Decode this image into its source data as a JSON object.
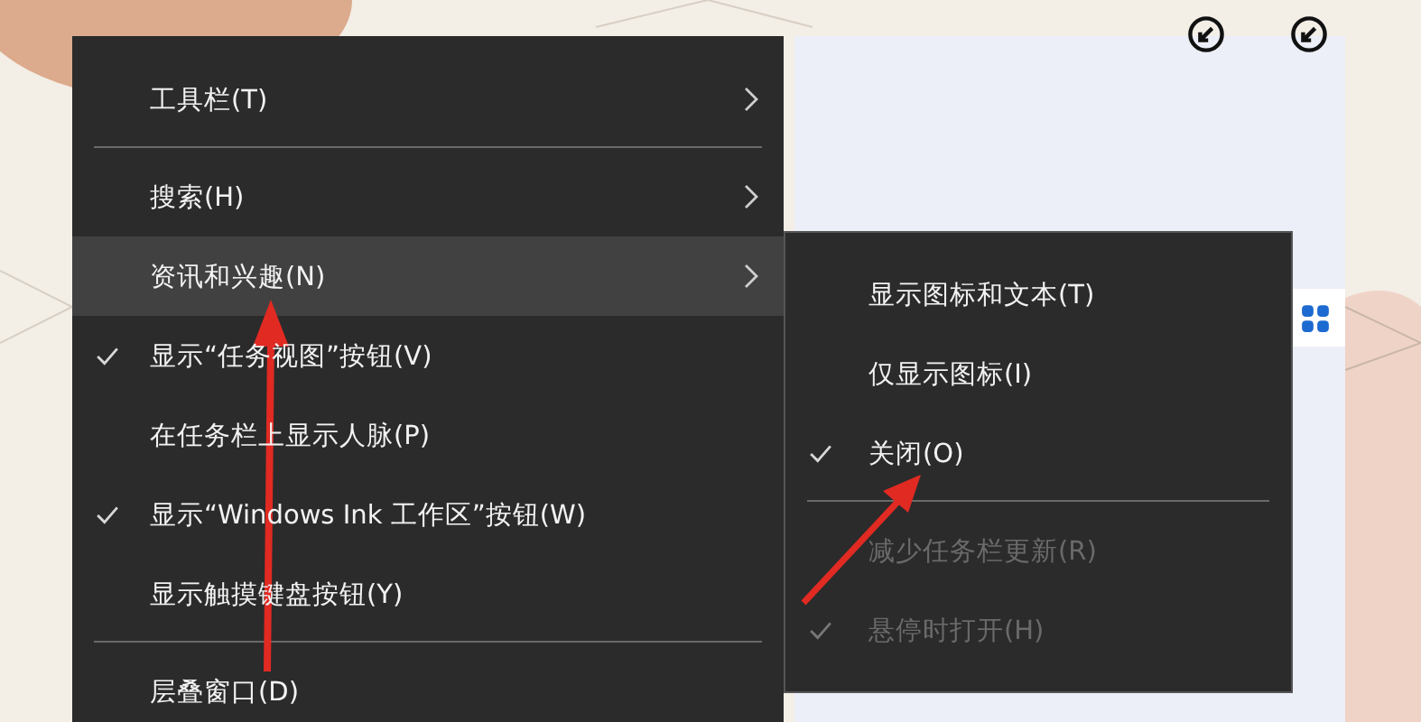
{
  "context_menu": {
    "items": [
      {
        "kind": "item",
        "label": "工具栏(T)",
        "checked": false,
        "submenu": true,
        "selected": false,
        "disabled": false
      },
      {
        "kind": "separator"
      },
      {
        "kind": "item",
        "label": "搜索(H)",
        "checked": false,
        "submenu": true,
        "selected": false,
        "disabled": false
      },
      {
        "kind": "item",
        "label": "资讯和兴趣(N)",
        "checked": false,
        "submenu": true,
        "selected": true,
        "disabled": false
      },
      {
        "kind": "item",
        "label": "显示“任务视图”按钮(V)",
        "checked": true,
        "submenu": false,
        "selected": false,
        "disabled": false
      },
      {
        "kind": "item",
        "label": "在任务栏上显示人脉(P)",
        "checked": false,
        "submenu": false,
        "selected": false,
        "disabled": false
      },
      {
        "kind": "item",
        "label": "显示“Windows Ink 工作区”按钮(W)",
        "checked": true,
        "submenu": false,
        "selected": false,
        "disabled": false
      },
      {
        "kind": "item",
        "label": "显示触摸键盘按钮(Y)",
        "checked": false,
        "submenu": false,
        "selected": false,
        "disabled": false
      },
      {
        "kind": "separator"
      },
      {
        "kind": "item",
        "label": "层叠窗口(D)",
        "checked": false,
        "submenu": false,
        "selected": false,
        "disabled": false
      }
    ]
  },
  "submenu": {
    "items": [
      {
        "kind": "item",
        "label": "显示图标和文本(T)",
        "checked": false,
        "disabled": false
      },
      {
        "kind": "item",
        "label": "仅显示图标(I)",
        "checked": false,
        "disabled": false
      },
      {
        "kind": "item",
        "label": "关闭(O)",
        "checked": true,
        "disabled": false
      },
      {
        "kind": "separator"
      },
      {
        "kind": "item",
        "label": "减少任务栏更新(R)",
        "checked": false,
        "disabled": true
      },
      {
        "kind": "item",
        "label": "悬停时打开(H)",
        "checked": true,
        "disabled": true
      }
    ]
  }
}
